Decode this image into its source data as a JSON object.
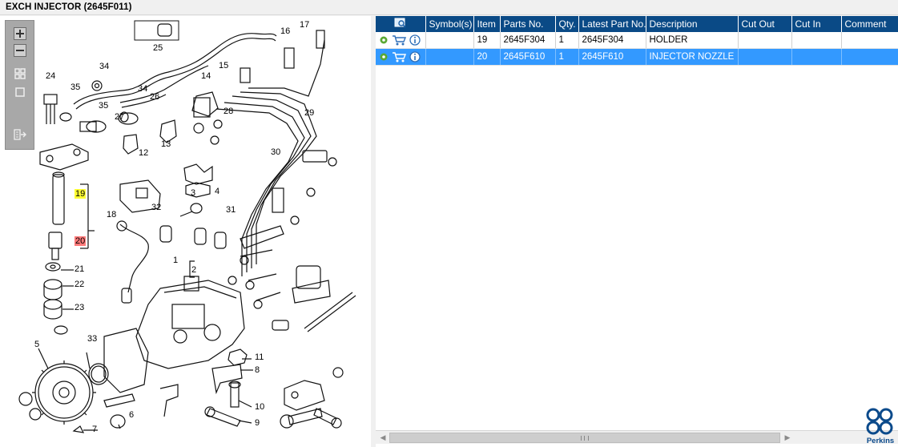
{
  "window": {
    "title": "EXCH INJECTOR (2645F011)"
  },
  "diagram": {
    "toolbar": [
      "zoom-in",
      "zoom-out",
      "fit-all",
      "actual-size",
      "export"
    ],
    "callouts": [
      {
        "id": "c24",
        "text": "24"
      },
      {
        "id": "c35a",
        "text": "35"
      },
      {
        "id": "c34a",
        "text": "34"
      },
      {
        "id": "c25",
        "text": "25"
      },
      {
        "id": "c34b",
        "text": "34"
      },
      {
        "id": "c26",
        "text": "26"
      },
      {
        "id": "c35b",
        "text": "35"
      },
      {
        "id": "c27",
        "text": "27"
      },
      {
        "id": "c12",
        "text": "12"
      },
      {
        "id": "c13",
        "text": "13"
      },
      {
        "id": "c14",
        "text": "14"
      },
      {
        "id": "c15",
        "text": "15"
      },
      {
        "id": "c16",
        "text": "16"
      },
      {
        "id": "c17",
        "text": "17"
      },
      {
        "id": "c28",
        "text": "28"
      },
      {
        "id": "c29",
        "text": "29"
      },
      {
        "id": "c30",
        "text": "30"
      },
      {
        "id": "c31",
        "text": "31"
      },
      {
        "id": "c32",
        "text": "32"
      },
      {
        "id": "c3",
        "text": "3"
      },
      {
        "id": "c4",
        "text": "4"
      },
      {
        "id": "c18",
        "text": "18"
      },
      {
        "id": "c19",
        "text": "19"
      },
      {
        "id": "c20",
        "text": "20"
      },
      {
        "id": "c21",
        "text": "21"
      },
      {
        "id": "c22",
        "text": "22"
      },
      {
        "id": "c23",
        "text": "23"
      },
      {
        "id": "c1",
        "text": "1"
      },
      {
        "id": "c2",
        "text": "2"
      },
      {
        "id": "c33",
        "text": "33"
      },
      {
        "id": "c5",
        "text": "5"
      },
      {
        "id": "c6",
        "text": "6"
      },
      {
        "id": "c7",
        "text": "7"
      },
      {
        "id": "c11",
        "text": "11"
      },
      {
        "id": "c8",
        "text": "8"
      },
      {
        "id": "c10",
        "text": "10"
      },
      {
        "id": "c9",
        "text": "9"
      }
    ]
  },
  "table": {
    "columns": [
      "",
      "Symbol(s)",
      "Item",
      "Parts No.",
      "Qty.",
      "Latest Part No.",
      "Description",
      "Cut Out",
      "Cut In",
      "Comment"
    ],
    "rows": [
      {
        "symbols": "",
        "item": "19",
        "part_no": "2645F304",
        "qty": "1",
        "latest_part_no": "2645F304",
        "description": "HOLDER",
        "cut_out": "",
        "cut_in": "",
        "comment": "",
        "selected": false
      },
      {
        "symbols": "",
        "item": "20",
        "part_no": "2645F610",
        "qty": "1",
        "latest_part_no": "2645F610",
        "description": "INJECTOR NOZZLE",
        "cut_out": "",
        "cut_in": "",
        "comment": "",
        "selected": true
      }
    ],
    "header_icon": "find-in-diagram-icon",
    "row_icons": [
      "settings-icon",
      "add-to-cart-icon",
      "info-icon"
    ]
  },
  "brand": {
    "name": "Perkins",
    "color": "#0b4a8b"
  },
  "colors": {
    "header": "#0a4a86",
    "selected_row": "#3399ff",
    "highlight_yellow": "#ffff33",
    "highlight_red": "#ff7a7a"
  }
}
